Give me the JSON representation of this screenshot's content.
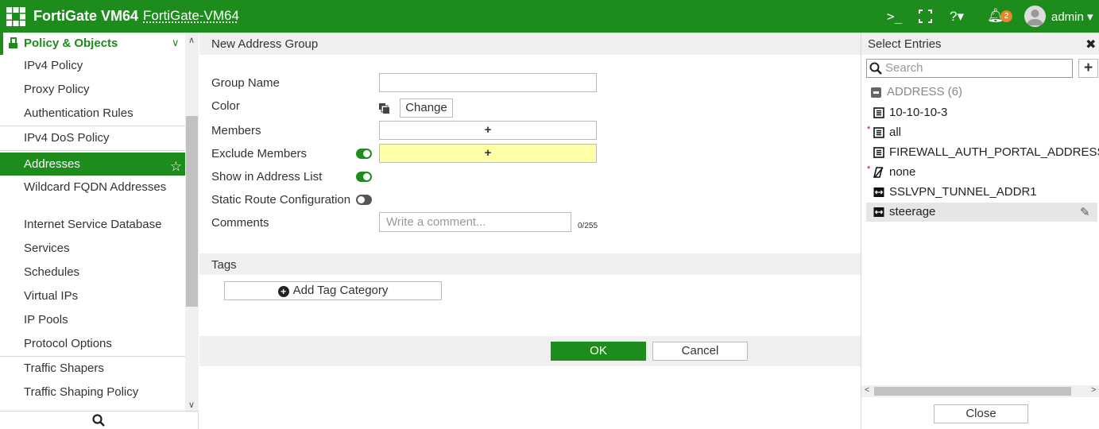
{
  "topbar": {
    "brand": "FortiGate VM64",
    "hostname": "FortiGate-VM64",
    "cli_icon": ">_",
    "help_icon": "?▾",
    "notification_count": "2",
    "user": "admin ▾",
    "brand_color": "#1d8c1d"
  },
  "sidebar": {
    "section_title": "Policy & Objects",
    "items": [
      {
        "label": "IPv4 Policy"
      },
      {
        "label": "Proxy Policy"
      },
      {
        "label": "Authentication Rules"
      },
      {
        "label": "IPv4 DoS Policy"
      },
      {
        "label": "Addresses",
        "active": true
      },
      {
        "label": "Wildcard FQDN Addresses"
      },
      {
        "label": "Internet Service Database"
      },
      {
        "label": "Services"
      },
      {
        "label": "Schedules"
      },
      {
        "label": "Virtual IPs"
      },
      {
        "label": "IP Pools"
      },
      {
        "label": "Protocol Options"
      },
      {
        "label": "Traffic Shapers"
      },
      {
        "label": "Traffic Shaping Policy"
      }
    ]
  },
  "form": {
    "title": "New Address Group",
    "labels": {
      "group_name": "Group Name",
      "color": "Color",
      "members": "Members",
      "exclude_members": "Exclude Members",
      "show_in_list": "Show in Address List",
      "static_route": "Static Route Configuration",
      "comments": "Comments"
    },
    "values": {
      "group_name": "",
      "members_add": "+",
      "exclude_add": "+",
      "exclude_members_enabled": true,
      "show_in_list_enabled": true,
      "static_route_enabled": false
    },
    "change_button": "Change",
    "comments_placeholder": "Write a comment...",
    "comment_counter": "0/255",
    "tags_title": "Tags",
    "add_tag_button": "Add Tag Category",
    "ok_button": "OK",
    "cancel_button": "Cancel"
  },
  "panel": {
    "title": "Select Entries",
    "search_placeholder": "Search",
    "group_header": "ADDRESS (6)",
    "entries": [
      {
        "label": "10-10-10-3",
        "icon": "address-list-icon",
        "required": false
      },
      {
        "label": "all",
        "icon": "address-list-icon",
        "required": true
      },
      {
        "label": "FIREWALL_AUTH_PORTAL_ADDRESS",
        "icon": "address-list-icon",
        "required": false
      },
      {
        "label": "none",
        "icon": "no-address-icon",
        "required": true
      },
      {
        "label": "SSLVPN_TUNNEL_ADDR1",
        "icon": "ip-range-icon",
        "required": false
      },
      {
        "label": "steerage",
        "icon": "ip-range-icon",
        "required": false,
        "selected": true
      }
    ],
    "close_button": "Close"
  }
}
